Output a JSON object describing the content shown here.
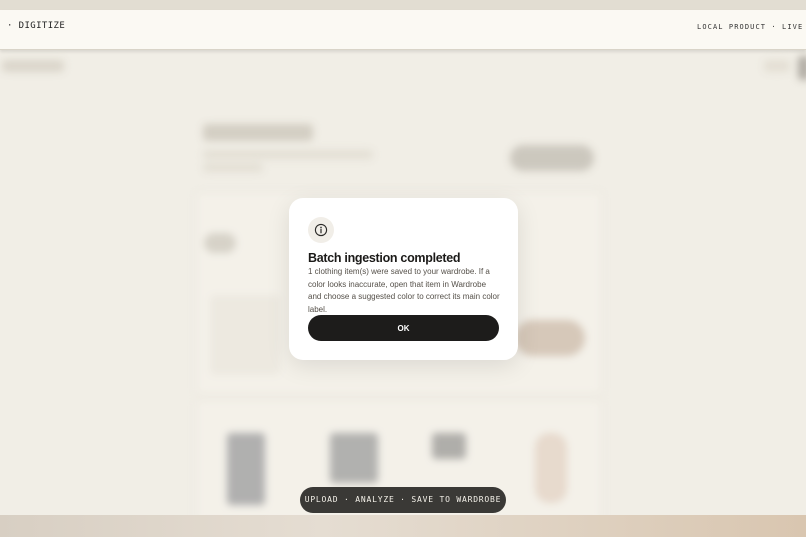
{
  "header": {
    "brand": "· DIGITIZE",
    "session": "LOCAL PRODUCT · LIVE SES"
  },
  "dialog": {
    "icon": "info-icon",
    "title": "Batch ingestion completed",
    "message": "1 clothing item(s) were saved to your wardrobe. If a color looks inaccurate, open that item in Wardrobe and choose a suggested color to correct its main color label.",
    "ok_label": "OK"
  },
  "footer_pill": {
    "label": "UPLOAD · ANALYZE · SAVE TO WARDROBE"
  },
  "colors": {
    "background": "#efece4",
    "header": "#fbf9f3",
    "dialog": "#ffffff",
    "primary_button": "#1d1c1b",
    "pill": "#3a3936"
  }
}
